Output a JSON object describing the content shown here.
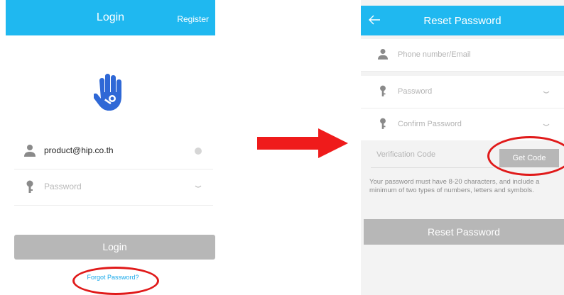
{
  "left": {
    "header": {
      "title": "Login",
      "register_label": "Register"
    },
    "email_value": "product@hip.co.th",
    "password_placeholder": "Password",
    "login_label": "Login",
    "forgot_label": "Forgot Password?"
  },
  "right": {
    "header": {
      "title": "Reset Password"
    },
    "phone_placeholder": "Phone number/Email",
    "password_placeholder": "Password",
    "confirm_placeholder": "Confirm Password",
    "code_placeholder": "Verification Code",
    "get_code_label": "Get Code",
    "hint_text": "Your password must have 8-20 characters, and include a minimum of two types of numbers, letters and symbols.",
    "reset_label": "Reset Password"
  },
  "colors": {
    "accent": "#1fb8f0",
    "highlight": "#e01a1a",
    "button_disabled": "#b7b7b7"
  }
}
